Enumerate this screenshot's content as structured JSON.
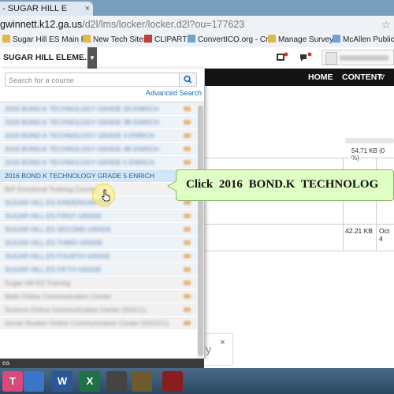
{
  "browser": {
    "tab_title": "- SUGAR HILL E",
    "tab_close": "×",
    "url_host": "gwinnett.k12.ga.us",
    "url_path": "/d2l/lms/locker/locker.d2l?ou=177623",
    "bookmarks": [
      {
        "label": "Sugar Hill ES Main P...",
        "icon": "folder-icon"
      },
      {
        "label": "New Tech Sites",
        "icon": "folder-icon"
      },
      {
        "label": "CLIPART",
        "icon": "folder-icon"
      },
      {
        "label": "ConvertICO.org - Cr...",
        "icon": "page-icon"
      },
      {
        "label": "Manage Surveys",
        "icon": "folder-icon"
      },
      {
        "label": "McAllen Public Li",
        "icon": "page-icon"
      }
    ]
  },
  "header": {
    "org_name": "SUGAR HILL ELEME...",
    "nav": {
      "home": "HOME",
      "content": "CONTENT"
    }
  },
  "course_dropdown": {
    "search_placeholder": "Search for a course",
    "advanced_search": "Advanced Search",
    "courses": [
      {
        "label": "2016 BOND.K TECHNOLOGY GRADE 3A ENRICH",
        "style": "blur"
      },
      {
        "label": "2016 BOND.K TECHNOLOGY GRADE 3B ENRICH",
        "style": "blur"
      },
      {
        "label": "2016 BOND.K TECHNOLOGY GRADE 4 ENRICH",
        "style": "blur"
      },
      {
        "label": "2016 BOND.K TECHNOLOGY GRADE 4B ENRICH",
        "style": "blur"
      },
      {
        "label": "2016 BOND.K TECHNOLOGY GRADE 5 ENRICH",
        "style": "blur"
      },
      {
        "label": "2016 BOND.K TECHNOLOGY GRADE 5 ENRICH",
        "style": "hl"
      },
      {
        "label": "BrP Emotional Training Course",
        "style": "alt"
      },
      {
        "label": "SUGAR HILL ES KINDERGARTEN",
        "style": "blur"
      },
      {
        "label": "SUGAR HILL ES FIRST GRADE",
        "style": "blur"
      },
      {
        "label": "SUGAR HILL ES SECOND GRADE",
        "style": "blur"
      },
      {
        "label": "SUGAR HILL ES THIRD GRADE",
        "style": "blur"
      },
      {
        "label": "SUGAR HILL ES FOURTH GRADE",
        "style": "blur"
      },
      {
        "label": "SUGAR HILL ES FIFTH GRADE",
        "style": "blur"
      },
      {
        "label": "Sugar Hill ES Training",
        "style": "alt"
      },
      {
        "label": "Math Online Communication Center",
        "style": "alt"
      },
      {
        "label": "Science Online Communication Center (SOCC)",
        "style": "alt"
      },
      {
        "label": "Social Studies Online Communication Center (SSOCC)",
        "style": "alt"
      }
    ]
  },
  "callout": {
    "text": "Click 2016 BOND.K TECHNOLOG"
  },
  "locker": {
    "size_header": "54.71 KB (0 %)",
    "row_size": "42.21 KB",
    "row_date": "Oct 4"
  },
  "card": {
    "text": "ly",
    "close": "×"
  },
  "taskbar": {
    "apps": [
      {
        "glyph": "T",
        "color": "#d84a7a",
        "icon": "tasks-icon"
      },
      {
        "glyph": "",
        "color": "#3a77c9",
        "icon": "chrome-icon"
      },
      {
        "glyph": "W",
        "color": "#2b5797",
        "icon": "word-icon"
      },
      {
        "glyph": "X",
        "color": "#1e7145",
        "icon": "excel-icon"
      },
      {
        "glyph": "",
        "color": "#444444",
        "icon": "snipping-icon"
      },
      {
        "glyph": "",
        "color": "#6d5a2e",
        "icon": "folder-icon"
      },
      {
        "glyph": "",
        "color": "#8a1e1e",
        "icon": "app-icon"
      }
    ]
  },
  "colors": {
    "nav_bg": "#141414",
    "link": "#1b6aa8",
    "callout_bg": "#dfffc4",
    "taskbar_bg": "#2b4863"
  }
}
